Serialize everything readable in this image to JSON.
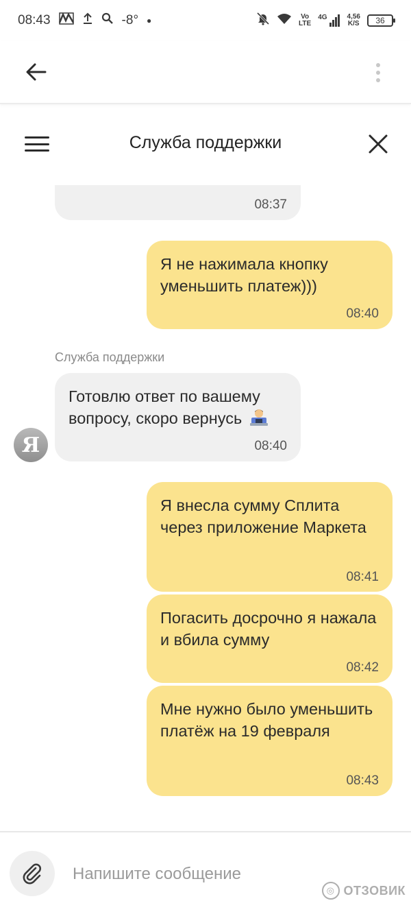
{
  "status_bar": {
    "time": "08:43",
    "temperature": "-8°",
    "volte_top": "Vo",
    "volte_bottom": "LTE",
    "network": "4G",
    "speed_value": "4,56",
    "speed_unit": "K/S",
    "battery": "36"
  },
  "app_bar": {
    "back_icon": "arrow-left-icon",
    "menu_icon": "more-vertical-icon"
  },
  "chat": {
    "title": "Служба поддержки",
    "menu_icon": "hamburger-icon",
    "close_icon": "close-icon"
  },
  "messages": [
    {
      "direction": "in",
      "text": "",
      "time": "08:37"
    },
    {
      "direction": "out",
      "text": "Я не нажимала кнопку уменьшить платеж)))",
      "time": "08:40"
    },
    {
      "direction": "in",
      "sender": "Служба поддержки",
      "avatar_letter": "Я",
      "text": "Готовлю ответ по вашему вопросу, скоро вернусь",
      "emoji": "technologist-emoji",
      "time": "08:40"
    },
    {
      "direction": "out",
      "text": "Я внесла сумму Сплита через приложение Маркета",
      "time": "08:41"
    },
    {
      "direction": "out",
      "text": "Погасить досрочно я нажала и вбила сумму",
      "time": "08:42"
    },
    {
      "direction": "out",
      "text": "Мне нужно было уменьшить платёж на 19 февраля",
      "time": "08:43"
    }
  ],
  "composer": {
    "placeholder": "Напишите сообщение",
    "attach_icon": "paperclip-icon"
  },
  "watermark": "ОТЗОВИК",
  "colors": {
    "outgoing_bubble": "#fbe38e",
    "incoming_bubble": "#f0f0f0"
  }
}
